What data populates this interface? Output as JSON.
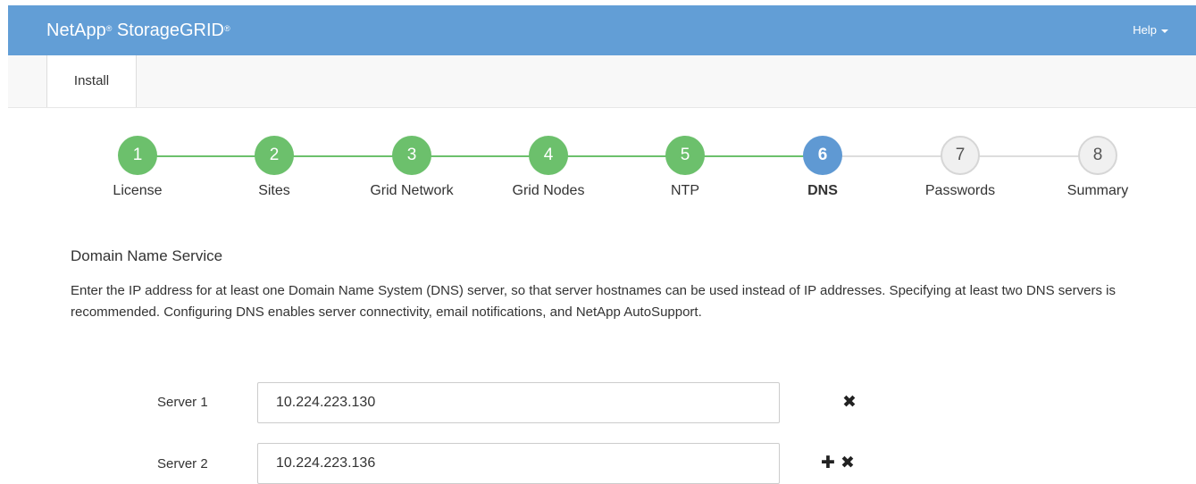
{
  "header": {
    "brand_name_1": "NetApp",
    "brand_sup_1": "®",
    "brand_name_2": " StorageGRID",
    "brand_sup_2": "®",
    "help_label": "Help",
    "background_color": "#629ed6"
  },
  "nav": {
    "tabs": [
      {
        "label": "Install",
        "active": true
      }
    ]
  },
  "stepper": {
    "steps": [
      {
        "number": "1",
        "label": "License",
        "state": "done"
      },
      {
        "number": "2",
        "label": "Sites",
        "state": "done"
      },
      {
        "number": "3",
        "label": "Grid Network",
        "state": "done"
      },
      {
        "number": "4",
        "label": "Grid Nodes",
        "state": "done"
      },
      {
        "number": "5",
        "label": "NTP",
        "state": "done"
      },
      {
        "number": "6",
        "label": "DNS",
        "state": "active"
      },
      {
        "number": "7",
        "label": "Passwords",
        "state": "todo"
      },
      {
        "number": "8",
        "label": "Summary",
        "state": "todo"
      }
    ],
    "colors": {
      "done": "#6cc06c",
      "active": "#5f99d3",
      "todo": "#f0f0f0"
    }
  },
  "dns": {
    "title": "Domain Name Service",
    "description": "Enter the IP address for at least one Domain Name System (DNS) server, so that server hostnames can be used instead of IP addresses. Specifying at least two DNS servers is recommended. Configuring DNS enables server connectivity, email notifications, and NetApp AutoSupport.",
    "servers": [
      {
        "label": "Server 1",
        "value": "10.224.223.130",
        "actions": [
          "remove-icon"
        ]
      },
      {
        "label": "Server 2",
        "value": "10.224.223.136",
        "actions": [
          "add-icon",
          "remove-icon"
        ]
      }
    ]
  }
}
